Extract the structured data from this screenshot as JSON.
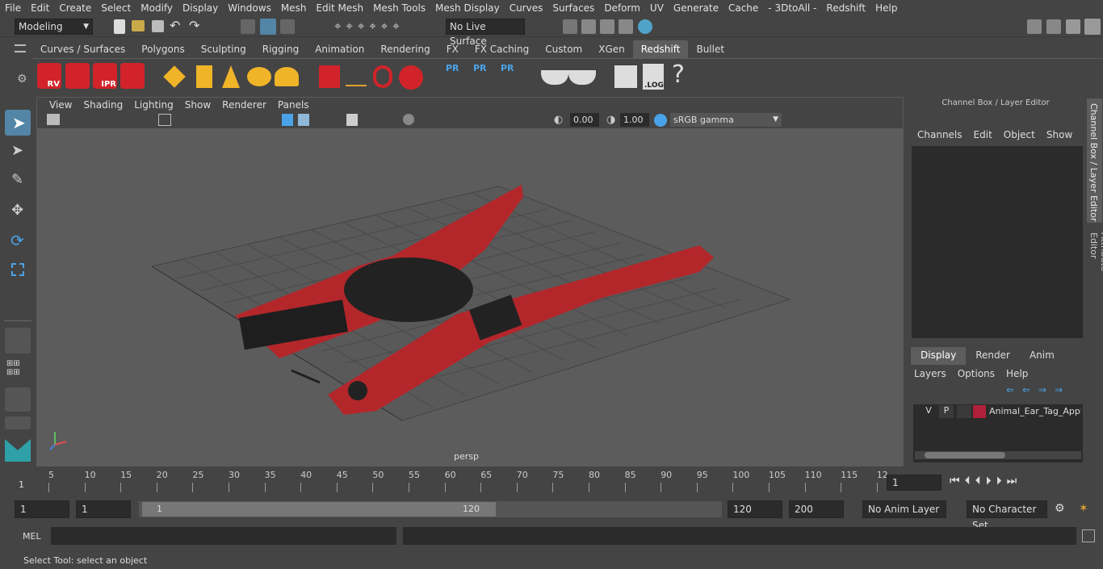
{
  "menu": [
    "File",
    "Edit",
    "Create",
    "Select",
    "Modify",
    "Display",
    "Windows",
    "Mesh",
    "Edit Mesh",
    "Mesh Tools",
    "Mesh Display",
    "Curves",
    "Surfaces",
    "Deform",
    "UV",
    "Generate",
    "Cache",
    "- 3DtoAll -",
    "Redshift",
    "Help"
  ],
  "status": {
    "mode": "Modeling",
    "live_surface": "No Live Surface"
  },
  "shelf_tabs": [
    "Curves / Surfaces",
    "Polygons",
    "Sculpting",
    "Rigging",
    "Animation",
    "Rendering",
    "FX",
    "FX Caching",
    "Custom",
    "XGen",
    "Redshift",
    "Bullet"
  ],
  "shelf_active": "Redshift",
  "shelf_labels": {
    "rv": "RV",
    "ipr": "IPR",
    "pr1": "PR",
    "pr2": "PR",
    "pr3": "PR",
    "log": ".LOG",
    "help": "?"
  },
  "viewport": {
    "menus": [
      "View",
      "Shading",
      "Lighting",
      "Show",
      "Renderer",
      "Panels"
    ],
    "exposure": "0.00",
    "gamma": "1.00",
    "color_space": "sRGB gamma",
    "camera_label": "persp"
  },
  "channel_box": {
    "title": "Channel Box / Layer Editor",
    "menus": [
      "Channels",
      "Edit",
      "Object",
      "Show"
    ]
  },
  "layer_editor": {
    "tabs": [
      "Display",
      "Render",
      "Anim"
    ],
    "active_tab": "Display",
    "menus": [
      "Layers",
      "Options",
      "Help"
    ],
    "layer": {
      "v": "V",
      "p": "P",
      "name": "Animal_Ear_Tag_Applic",
      "color": "#b0203a"
    }
  },
  "side_tabs": [
    "Channel Box / Layer Editor",
    "Attribute Editor"
  ],
  "timeline": {
    "ticks": [
      "5",
      "10",
      "15",
      "20",
      "25",
      "30",
      "35",
      "40",
      "45",
      "50",
      "55",
      "60",
      "65",
      "70",
      "75",
      "80",
      "85",
      "90",
      "95",
      "100",
      "105",
      "110",
      "115",
      "12"
    ],
    "start_marker": "1",
    "current_frame": "1"
  },
  "range": {
    "start": "1",
    "anim_start": "1",
    "slider_start": "1",
    "slider_end": "120",
    "end": "120",
    "anim_end": "200",
    "anim_layer": "No Anim Layer",
    "character_set": "No Character Set"
  },
  "command": {
    "lang": "MEL"
  },
  "help_line": "Select Tool: select an object",
  "colors": {
    "accent": "#5285a6",
    "object_red": "#b3272b",
    "redshift_red": "#d2232a"
  }
}
